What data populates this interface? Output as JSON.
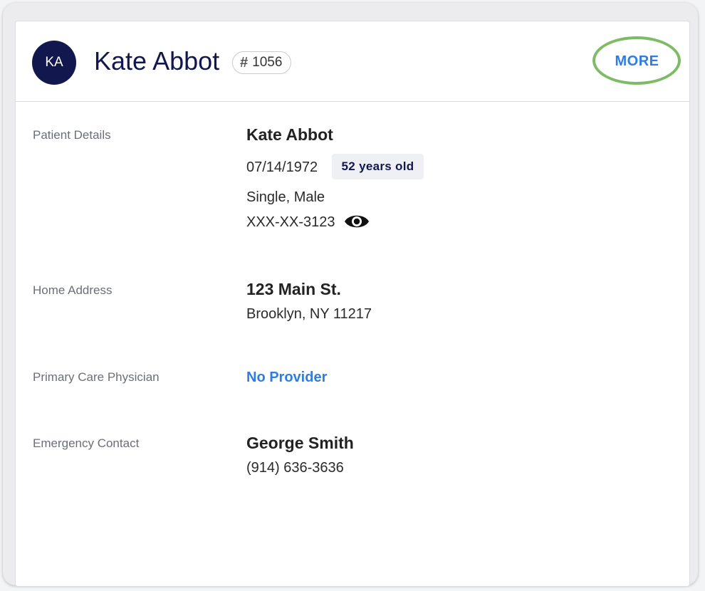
{
  "header": {
    "avatar_initials": "KA",
    "patient_name": "Kate Abbot",
    "patient_id_symbol": "#",
    "patient_id": "1056",
    "more_label": "MORE"
  },
  "patient_details": {
    "label": "Patient Details",
    "name": "Kate Abbot",
    "dob": "07/14/1972",
    "age": "52 years old",
    "marital_gender": "Single, Male",
    "ssn_masked": "XXX-XX-3123"
  },
  "home_address": {
    "label": "Home Address",
    "line1": "123 Main St.",
    "line2": "Brooklyn, NY 11217"
  },
  "primary_care": {
    "label": "Primary Care Physician",
    "value": "No Provider"
  },
  "emergency_contact": {
    "label": "Emergency Contact",
    "name": "George Smith",
    "phone": "(914) 636-3636"
  },
  "colors": {
    "navy": "#12184e",
    "link_blue": "#2f7de1",
    "highlight_green": "#7dbb65"
  },
  "icons": {
    "eye": "eye-icon",
    "hash": "hash-icon"
  }
}
